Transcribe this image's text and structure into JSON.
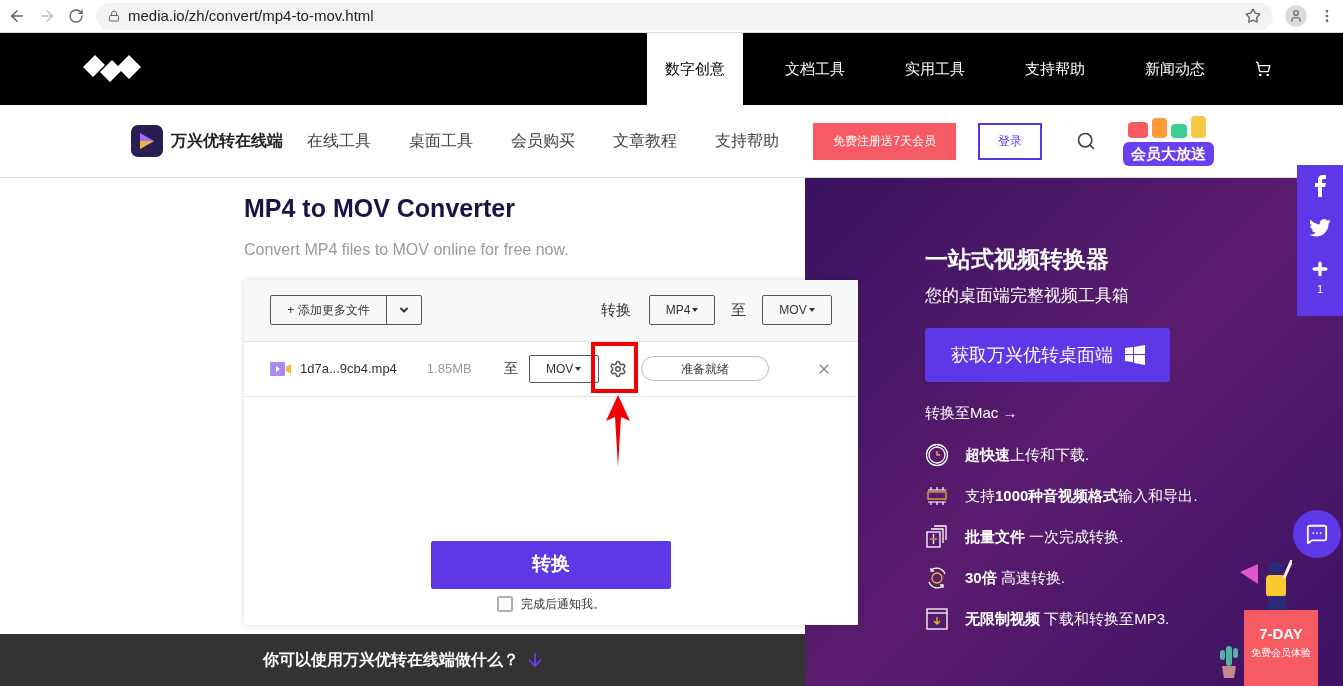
{
  "browser": {
    "url": "media.io/zh/convert/mp4-to-mov.html"
  },
  "top_nav": {
    "items": [
      {
        "label": "数字创意",
        "selected": true
      },
      {
        "label": "文档工具",
        "selected": false
      },
      {
        "label": "实用工具",
        "selected": false
      },
      {
        "label": "支持帮助",
        "selected": false
      },
      {
        "label": "新闻动态",
        "selected": false
      }
    ]
  },
  "sub_nav": {
    "brand": "万兴优转在线端",
    "items": [
      "在线工具",
      "桌面工具",
      "会员购买",
      "文章教程",
      "支持帮助"
    ],
    "register_button": "免费注册送7天会员",
    "login_button": "登录",
    "promo_badge": "会员大放送"
  },
  "converter": {
    "title": "MP4 to MOV Converter",
    "subtitle": "Convert MP4 files to MOV online for free now.",
    "add_files_button": "+ 添加更多文件",
    "convert_label": "转换",
    "from_format": "MP4",
    "to_label": "至",
    "to_format": "MOV",
    "file": {
      "name": "1d7a...9cb4.mp4",
      "size": "1.85MB",
      "to_label": "至",
      "format": "MOV",
      "status": "准备就绪"
    },
    "convert_button": "转换",
    "notify": {
      "label": "完成后通知我。",
      "checked": false
    }
  },
  "promo": {
    "title": "一站式视频转换器",
    "subtitle": "您的桌面端完整视频工具箱",
    "download_button": "获取万兴优转桌面端",
    "mac_link": "转换至Mac →",
    "features": [
      {
        "kind": "clock",
        "text": "**超快速**上传和下载."
      },
      {
        "kind": "formats",
        "text": "支持**1000种音视频格式**输入和导出."
      },
      {
        "kind": "batch",
        "text": "**批量文件** 一次完成转换."
      },
      {
        "kind": "speed",
        "text": "**30倍** 高速转换."
      },
      {
        "kind": "download",
        "text": "**无限制视频** 下载和转换至MP3."
      }
    ],
    "gift": {
      "title": "7-DAY",
      "subtitle": "免费会员体验"
    }
  },
  "social": {
    "share_count": "1"
  },
  "bottom": {
    "question": "你可以使用万兴优转在线端做什么？"
  }
}
